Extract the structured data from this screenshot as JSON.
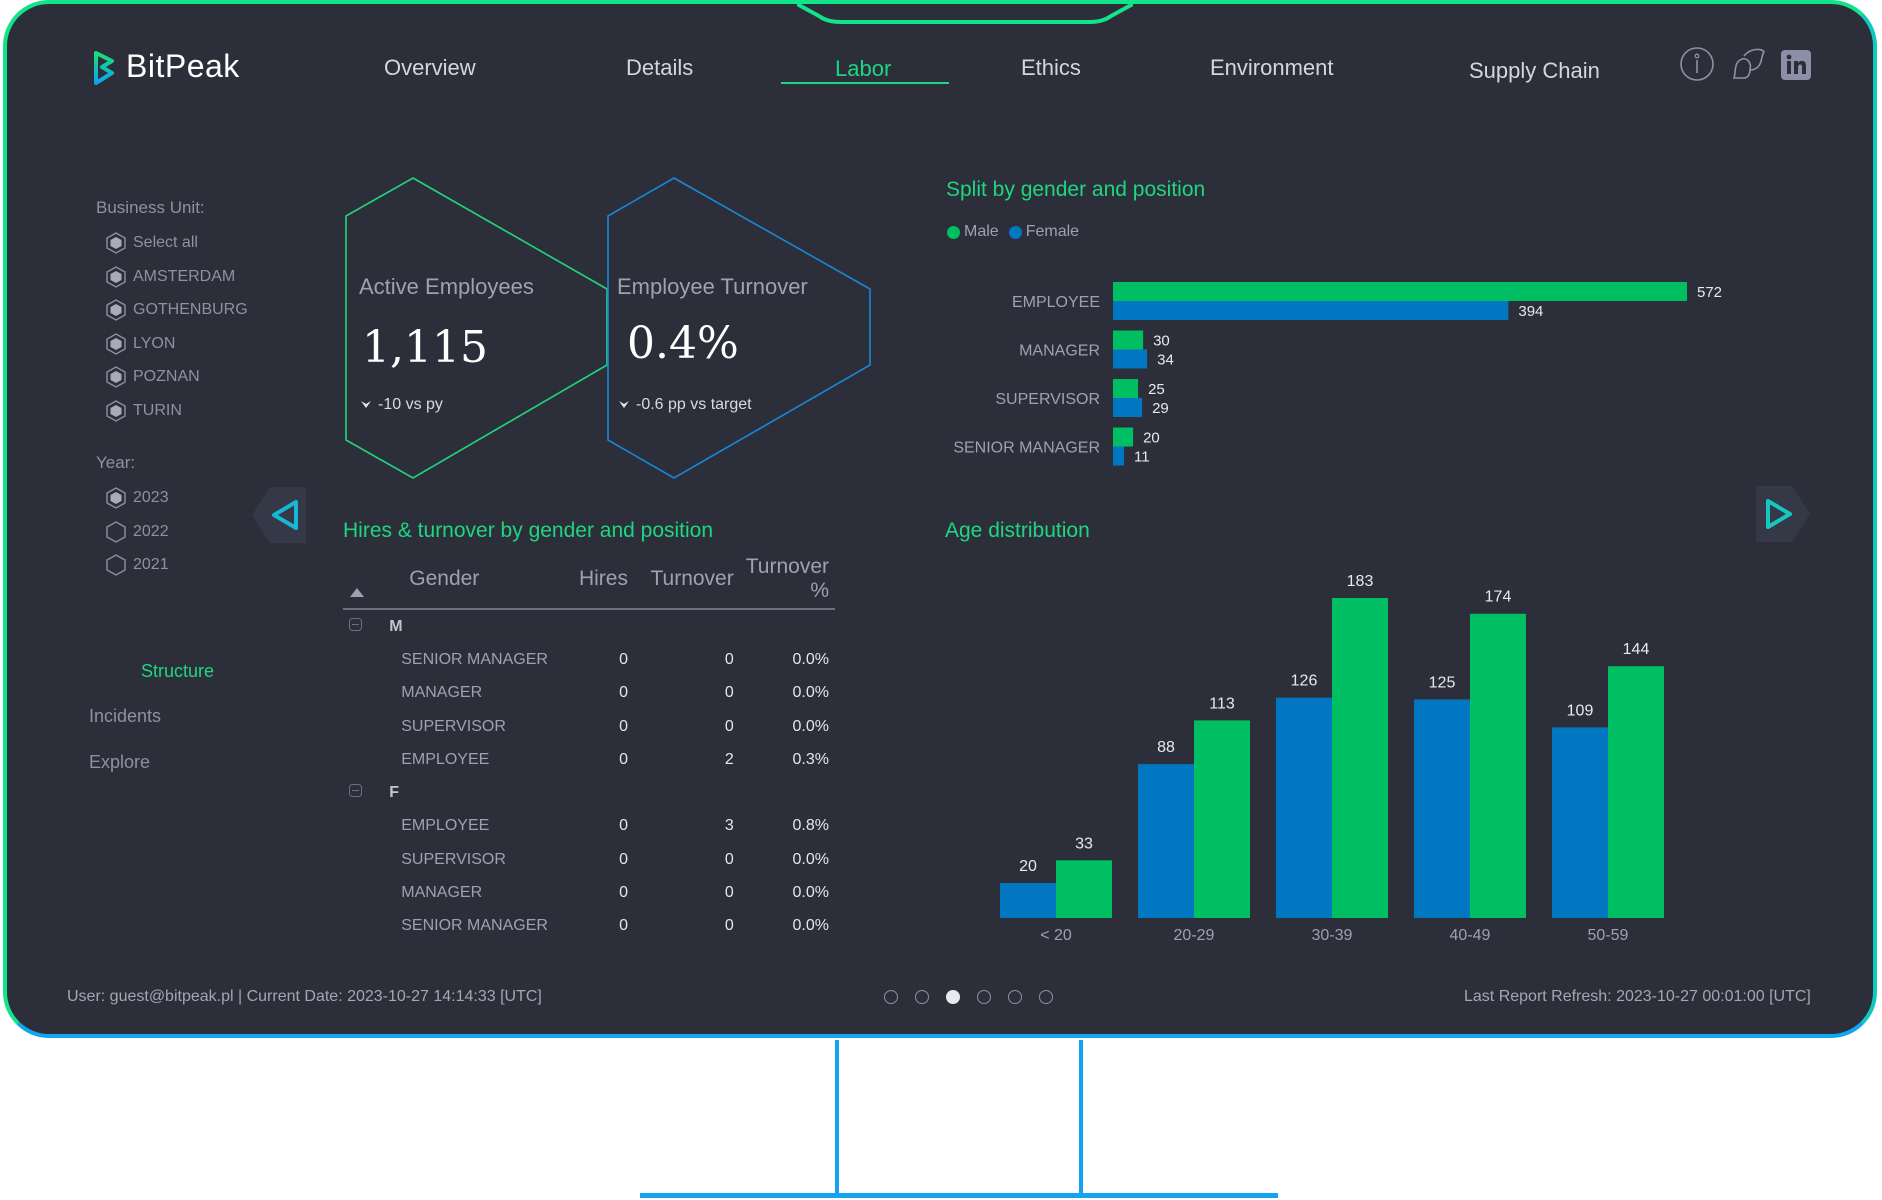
{
  "app": {
    "brand": "BitPeak"
  },
  "nav": {
    "tabs": [
      {
        "label": "Overview",
        "active": false
      },
      {
        "label": "Details",
        "active": false
      },
      {
        "label": "Labor",
        "active": true
      },
      {
        "label": "Ethics",
        "active": false
      },
      {
        "label": "Environment",
        "active": false
      },
      {
        "label": "Supply Chain",
        "active": false
      }
    ],
    "icons": [
      "info-icon",
      "chat-icon",
      "linkedin-icon"
    ]
  },
  "filters": {
    "business_unit_label": "Business Unit:",
    "business_units": [
      {
        "label": "Select all",
        "checked": true
      },
      {
        "label": "AMSTERDAM",
        "checked": true
      },
      {
        "label": "GOTHENBURG",
        "checked": true
      },
      {
        "label": "LYON",
        "checked": true
      },
      {
        "label": "POZNAN",
        "checked": true
      },
      {
        "label": "TURIN",
        "checked": true
      }
    ],
    "year_label": "Year:",
    "years": [
      {
        "label": "2023",
        "checked": true
      },
      {
        "label": "2022",
        "checked": false
      },
      {
        "label": "2021",
        "checked": false
      }
    ]
  },
  "side_nav": [
    {
      "label": "Structure",
      "active": true
    },
    {
      "label": "Incidents",
      "active": false
    },
    {
      "label": "Explore",
      "active": false
    }
  ],
  "kpis": [
    {
      "title": "Active Employees",
      "value": "1,115",
      "delta": "-10 vs py",
      "color": "#1ed67f"
    },
    {
      "title": "Employee Turnover",
      "value": "0.4%",
      "delta": "-0.6 pp vs target",
      "color": "#1a86d6"
    }
  ],
  "colors": {
    "male": "#00bf63",
    "female": "#0077c0",
    "accent": "#1ed67f"
  },
  "hires_table": {
    "title": "Hires & turnover by gender and position",
    "columns": [
      "Gender",
      "Hires",
      "Turnover",
      "Turnover %"
    ],
    "groups": [
      {
        "label": "M",
        "rows": [
          {
            "position": "SENIOR MANAGER",
            "hires": "0",
            "turnover": "0",
            "pct": "0.0%"
          },
          {
            "position": "MANAGER",
            "hires": "0",
            "turnover": "0",
            "pct": "0.0%"
          },
          {
            "position": "SUPERVISOR",
            "hires": "0",
            "turnover": "0",
            "pct": "0.0%"
          },
          {
            "position": "EMPLOYEE",
            "hires": "0",
            "turnover": "2",
            "pct": "0.3%"
          }
        ]
      },
      {
        "label": "F",
        "rows": [
          {
            "position": "EMPLOYEE",
            "hires": "0",
            "turnover": "3",
            "pct": "0.8%"
          },
          {
            "position": "SUPERVISOR",
            "hires": "0",
            "turnover": "0",
            "pct": "0.0%"
          },
          {
            "position": "MANAGER",
            "hires": "0",
            "turnover": "0",
            "pct": "0.0%"
          },
          {
            "position": "SENIOR MANAGER",
            "hires": "0",
            "turnover": "0",
            "pct": "0.0%"
          }
        ]
      }
    ]
  },
  "chart_data": [
    {
      "type": "bar",
      "orientation": "horizontal",
      "title": "Split by gender and position",
      "legend": [
        "Male",
        "Female"
      ],
      "legend_position": "top-left",
      "categories": [
        "EMPLOYEE",
        "MANAGER",
        "SUPERVISOR",
        "SENIOR MANAGER"
      ],
      "series": [
        {
          "name": "Male",
          "values": [
            572,
            30,
            25,
            20
          ]
        },
        {
          "name": "Female",
          "values": [
            394,
            34,
            29,
            11
          ]
        }
      ],
      "grid": false
    },
    {
      "type": "bar",
      "orientation": "vertical",
      "title": "Age distribution",
      "categories": [
        "< 20",
        "20-29",
        "30-39",
        "40-49",
        "50-59"
      ],
      "series": [
        {
          "name": "Female",
          "values": [
            20,
            88,
            126,
            125,
            109
          ]
        },
        {
          "name": "Male",
          "values": [
            33,
            113,
            183,
            174,
            144
          ]
        }
      ],
      "ylim": [
        0,
        183
      ],
      "grid": false
    }
  ],
  "footer": {
    "user_info": "User: guest@bitpeak.pl | Current Date: 2023-10-27 14:14:33 [UTC]",
    "refresh": "Last Report Refresh: 2023-10-27 00:01:00 [UTC]",
    "pages": 6,
    "active_page": 3
  }
}
